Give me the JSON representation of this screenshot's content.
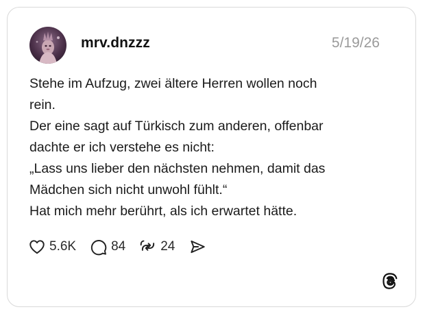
{
  "post": {
    "username": "mrv.dnzzz",
    "date": "5/19/26",
    "lines": [
      "Stehe im Aufzug, zwei ältere Herren wollen noch",
      "rein.",
      "Der eine sagt auf Türkisch zum anderen, offenbar",
      "dachte er ich verstehe es nicht:",
      "„Lass uns lieber den nächsten nehmen, damit das",
      "Mädchen sich nicht unwohl fühlt.“",
      "Hat mich mehr berührt, als ich erwartet hätte."
    ]
  },
  "actions": {
    "likes": "5.6K",
    "replies": "84",
    "reposts": "24"
  },
  "icons": {
    "like": "heart-icon",
    "reply": "speech-bubble-icon",
    "repost": "repost-arrows-icon",
    "share": "send-icon",
    "brand": "threads-logo-icon"
  },
  "colors": {
    "text": "#1a1a1a",
    "muted": "#9a9a9a",
    "border": "#d9d9d9"
  }
}
